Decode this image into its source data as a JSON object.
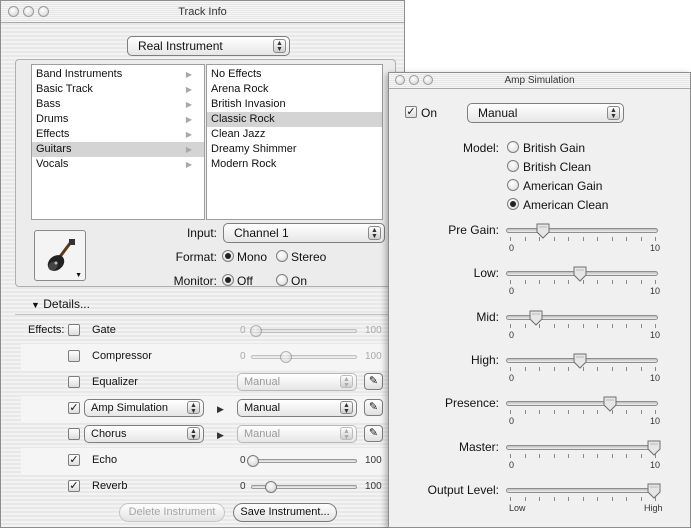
{
  "track_info": {
    "title": "Track Info",
    "instrument_type": "Real Instrument",
    "categories": [
      {
        "label": "Band Instruments",
        "selected": false
      },
      {
        "label": "Basic Track",
        "selected": false
      },
      {
        "label": "Bass",
        "selected": false
      },
      {
        "label": "Drums",
        "selected": false
      },
      {
        "label": "Effects",
        "selected": false
      },
      {
        "label": "Guitars",
        "selected": true
      },
      {
        "label": "Vocals",
        "selected": false
      }
    ],
    "presets": [
      {
        "label": "No Effects",
        "selected": false
      },
      {
        "label": "Arena Rock",
        "selected": false
      },
      {
        "label": "British Invasion",
        "selected": false
      },
      {
        "label": "Classic Rock",
        "selected": true
      },
      {
        "label": "Clean Jazz",
        "selected": false
      },
      {
        "label": "Dreamy Shimmer",
        "selected": false
      },
      {
        "label": "Modern Rock",
        "selected": false
      }
    ],
    "input_label": "Input:",
    "input_value": "Channel 1",
    "format_label": "Format:",
    "format_mono": "Mono",
    "format_stereo": "Stereo",
    "format_selected": "Mono",
    "monitor_label": "Monitor:",
    "monitor_off": "Off",
    "monitor_on": "On",
    "monitor_selected": "Off",
    "details_label": "Details...",
    "effects_label": "Effects:",
    "effects": [
      {
        "name": "Gate",
        "checked": false,
        "kind": "slider",
        "min": "0",
        "max": "100",
        "value_fraction": 0.05,
        "enabled": false
      },
      {
        "name": "Compressor",
        "checked": false,
        "kind": "slider",
        "min": "0",
        "max": "100",
        "value_fraction": 0.35,
        "enabled": false
      },
      {
        "name": "Equalizer",
        "checked": false,
        "kind": "preset",
        "preset": "Manual",
        "enabled": false
      },
      {
        "name": "Amp Simulation",
        "checked": true,
        "kind": "popup-preset",
        "preset": "Manual",
        "enabled": true
      },
      {
        "name": "Chorus",
        "checked": false,
        "kind": "popup-preset",
        "preset": "Manual",
        "enabled": false
      },
      {
        "name": "Echo",
        "checked": true,
        "kind": "slider",
        "min": "0",
        "max": "100",
        "value_fraction": 0.02,
        "enabled": true
      },
      {
        "name": "Reverb",
        "checked": true,
        "kind": "slider",
        "min": "0",
        "max": "100",
        "value_fraction": 0.2,
        "enabled": true
      }
    ],
    "delete_button": "Delete Instrument",
    "save_button": "Save Instrument..."
  },
  "amp_sim": {
    "title": "Amp Simulation",
    "on_label": "On",
    "on_checked": true,
    "preset": "Manual",
    "model_label": "Model:",
    "models": [
      {
        "label": "British Gain",
        "selected": false
      },
      {
        "label": "British Clean",
        "selected": false
      },
      {
        "label": "American Gain",
        "selected": false
      },
      {
        "label": "American Clean",
        "selected": true
      }
    ],
    "sliders": [
      {
        "label": "Pre Gain:",
        "min": "0",
        "max": "10",
        "value": 2.5
      },
      {
        "label": "Low:",
        "min": "0",
        "max": "10",
        "value": 5.0
      },
      {
        "label": "Mid:",
        "min": "0",
        "max": "10",
        "value": 2.0
      },
      {
        "label": "High:",
        "min": "0",
        "max": "10",
        "value": 5.0
      },
      {
        "label": "Presence:",
        "min": "0",
        "max": "10",
        "value": 7.0
      },
      {
        "label": "Master:",
        "min": "0",
        "max": "10",
        "value": 10.0
      },
      {
        "label": "Output Level:",
        "min": "Low",
        "max": "High",
        "value": 10.0
      }
    ]
  }
}
